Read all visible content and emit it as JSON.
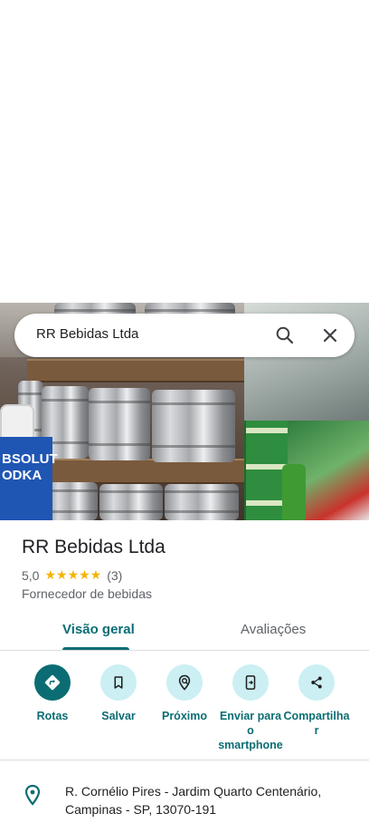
{
  "search": {
    "query": "RR Bebidas Ltda"
  },
  "place": {
    "name": "RR Bebidas Ltda",
    "rating": "5,0",
    "stars": "★★★★★",
    "review_count": "(3)",
    "category": "Fornecedor de bebidas"
  },
  "photo": {
    "box_text_1": "BSOLUT",
    "box_text_2": "ODKA"
  },
  "tabs": [
    {
      "label": "Visão geral",
      "selected": true
    },
    {
      "label": "Avaliações",
      "selected": false
    }
  ],
  "actions": [
    {
      "label": "Rotas",
      "icon": "directions-icon"
    },
    {
      "label": "Salvar",
      "icon": "bookmark-icon"
    },
    {
      "label": "Próximo",
      "icon": "nearby-icon"
    },
    {
      "label": "Enviar para o smartphone",
      "icon": "send-to-phone-icon"
    },
    {
      "label": "Compartilhar",
      "icon": "share-icon"
    }
  ],
  "address": {
    "text": "R. Cornélio Pires - Jardim Quarto Centenário, Campinas - SP, 13070-191"
  },
  "colors": {
    "accent": "#0b6d73",
    "accent_light": "#cbeff3",
    "star": "#f4b400"
  }
}
